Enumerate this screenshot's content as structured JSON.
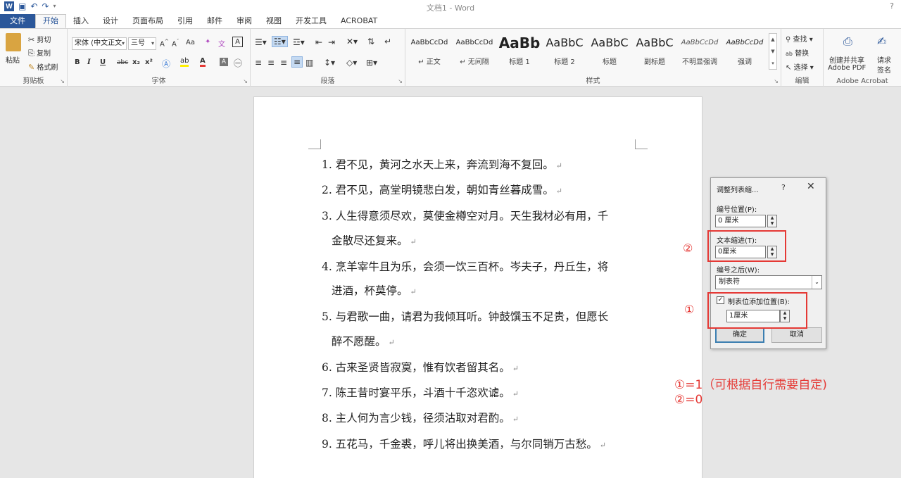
{
  "window": {
    "title": "文档1 - Word",
    "help": "?"
  },
  "tabs": [
    "文件",
    "开始",
    "插入",
    "设计",
    "页面布局",
    "引用",
    "邮件",
    "审阅",
    "视图",
    "开发工具",
    "ACROBAT"
  ],
  "ribbon": {
    "clipboard": {
      "paste": "粘贴",
      "cut": "剪切",
      "copy": "复制",
      "format_painter": "格式刷",
      "label": "剪贴板"
    },
    "font": {
      "font_name": "宋体 (中文正文",
      "font_size": "三号",
      "aa": "Aa",
      "bold": "B",
      "italic": "I",
      "underline": "U",
      "strike": "abc",
      "sub": "x₂",
      "sup": "x²",
      "label": "字体"
    },
    "paragraph": {
      "label": "段落"
    },
    "styles": {
      "label": "样式",
      "items": [
        {
          "sample": "AaBbCcDd",
          "name": "↵ 正文"
        },
        {
          "sample": "AaBbCcDd",
          "name": "↵ 无间隔"
        },
        {
          "sample": "AaBb",
          "name": "标题 1"
        },
        {
          "sample": "AaBbC",
          "name": "标题 2"
        },
        {
          "sample": "AaBbC",
          "name": "标题"
        },
        {
          "sample": "AaBbC",
          "name": "副标题"
        },
        {
          "sample": "AaBbCcDd",
          "name": "不明显强调"
        },
        {
          "sample": "AaBbCcDd",
          "name": "强调"
        }
      ]
    },
    "editing": {
      "find": "查找",
      "replace": "替换",
      "select": "选择",
      "label": "编辑"
    },
    "acrobat": {
      "create": "创建并共享",
      "create2": "Adobe PDF",
      "sign": "请求",
      "sign2": "签名",
      "label": "Adobe Acrobat"
    }
  },
  "document": {
    "lines": [
      "1.  君不见，黄河之水天上来，奔流到海不复回。",
      "2.  君不见，高堂明镜悲白发，朝如青丝暮成雪。",
      "3.  人生得意须尽欢，莫使金樽空对月。天生我材必有用，千",
      "金散尽还复来。",
      "4.  烹羊宰牛且为乐，会须一饮三百杯。岑夫子，丹丘生，将",
      "进酒，杯莫停。",
      "5.  与君歌一曲，请君为我倾耳听。钟鼓馔玉不足贵，但愿长",
      "醉不愿醒。",
      "6.  古来圣贤皆寂寞，惟有饮者留其名。",
      "7.  陈王昔时宴平乐，斗酒十千恣欢谑。",
      "8.  主人何为言少钱，径须沽取对君酌。",
      "9.  五花马，千金裘，呼儿将出换美酒，与尔同销万古愁。"
    ],
    "para_mark": "↵"
  },
  "dialog": {
    "title": "调整列表缩...",
    "help": "?",
    "close": "✕",
    "number_position_label": "编号位置(P):",
    "number_position_value": "0 厘米",
    "text_indent_label": "文本缩进(T):",
    "text_indent_value": "0厘米",
    "follow_label": "编号之后(W):",
    "follow_value": "制表符",
    "tab_checkbox_label": "制表位添加位置(B):",
    "tab_checked": "✓",
    "tab_value": "1厘米",
    "ok": "确定",
    "cancel": "取消"
  },
  "annotations": {
    "circle2": "②",
    "circle1": "①",
    "note1": "①=1（可根据自行需要自定)",
    "note2": "②=0"
  },
  "colors": {
    "accent": "#2b579a",
    "annotation": "#e53935"
  }
}
